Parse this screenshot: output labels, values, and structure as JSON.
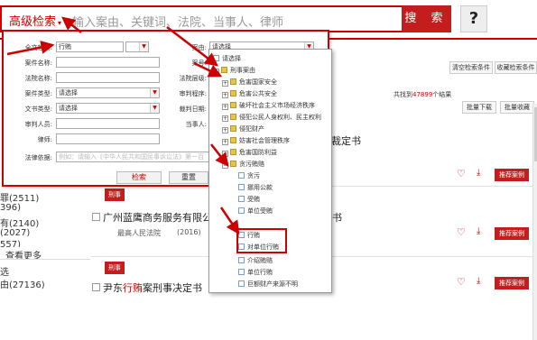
{
  "header": {
    "adv_label": "高级检索",
    "adv_caret": "▾",
    "search_placeholder": "输入案由、关键词、法院、当事人、律师",
    "search_button": "搜 索",
    "help_button": "?"
  },
  "left_sidebar": {
    "items": [
      "罪(2511)",
      "396)",
      "有(2140)",
      "(2027)",
      "557)"
    ],
    "more": "查看更多",
    "section": "选",
    "last_item": "由(27136)"
  },
  "results": {
    "toolbar": {
      "clear_conditions": "清空检索条件",
      "save_conditions": "收藏检索条件",
      "batch_download": "批量下载",
      "batch_save": "批量收藏"
    },
    "count_prefix": "共找到",
    "count_num": "47899",
    "count_suffix": "个结果",
    "partial_title": "纠纷申诉、申请民事裁定书",
    "cases": [
      {
        "tag": "刑事",
        "title_pre": "广州蓝鹰商务服务有限公",
        "title_hl": "",
        "title_post": "",
        "title_tail": "书",
        "court": "最高人民法院",
        "year": "(2016)",
        "recommend": "推荐案例"
      },
      {
        "tag": "刑事",
        "title_pre": "尹东",
        "title_hl": "行贿",
        "title_post": "案刑事决定书",
        "title_tail": "",
        "court": "",
        "year": "",
        "recommend": "推荐案例"
      }
    ],
    "recommend_top": "推荐案例"
  },
  "adv_panel": {
    "fields": {
      "fulltext_label": "全文检索:",
      "fulltext_value": "行贿",
      "case_reason_label": "案由:",
      "case_reason_value": "请选择",
      "case_name_label": "案件名称:",
      "case_no_label": "案号:",
      "court_name_label": "法院名称:",
      "court_level_label": "法院层级:",
      "case_type_label": "案件类型:",
      "case_type_value": "请选择",
      "trial_proc_label": "审判程序:",
      "doc_type_label": "文书类型:",
      "doc_type_value": "请选择",
      "judge_date_label": "裁判日期:",
      "judge_label": "审判人员:",
      "party_label": "当事人:",
      "lawyer_label": "律师:",
      "law_basis_label": "法律依据:",
      "law_basis_placeholder": "例如：请输入《中华人民共和国民事诉讼法》第一百"
    },
    "search_button": "检索",
    "reset_button": "重置"
  },
  "tree": {
    "items": [
      {
        "text": "请选择",
        "kind": "doc",
        "pm": ""
      },
      {
        "text": "刑事案由",
        "kind": "fold",
        "pm": "−"
      },
      {
        "text": "危害国家安全",
        "kind": "fold",
        "pm": "+"
      },
      {
        "text": "危害公共安全",
        "kind": "fold",
        "pm": "+"
      },
      {
        "text": "破坏社会主义市场经济秩序",
        "kind": "fold",
        "pm": "+"
      },
      {
        "text": "侵犯公民人身权利、民主权利",
        "kind": "fold",
        "pm": "+"
      },
      {
        "text": "侵犯财产",
        "kind": "fold",
        "pm": "+"
      },
      {
        "text": "妨害社会管理秩序",
        "kind": "fold",
        "pm": "+"
      },
      {
        "text": "危害国防利益",
        "kind": "fold",
        "pm": "+"
      },
      {
        "text": "贪污贿赂",
        "kind": "fold",
        "pm": "−"
      },
      {
        "text": "贪污",
        "kind": "doc",
        "pm": ""
      },
      {
        "text": "挪用公款",
        "kind": "doc",
        "pm": ""
      },
      {
        "text": "受贿",
        "kind": "doc",
        "pm": ""
      },
      {
        "text": "单位受贿",
        "kind": "doc",
        "pm": ""
      },
      {
        "text": "行贿",
        "kind": "doc",
        "pm": ""
      },
      {
        "text": "对单位行贿",
        "kind": "doc",
        "pm": ""
      },
      {
        "text": "介绍贿赂",
        "kind": "doc",
        "pm": ""
      },
      {
        "text": "单位行贿",
        "kind": "doc",
        "pm": ""
      },
      {
        "text": "巨额财产来源不明",
        "kind": "doc",
        "pm": ""
      }
    ]
  },
  "colors": {
    "accent": "#c41d1d",
    "highlight_border": "#cc0000"
  }
}
